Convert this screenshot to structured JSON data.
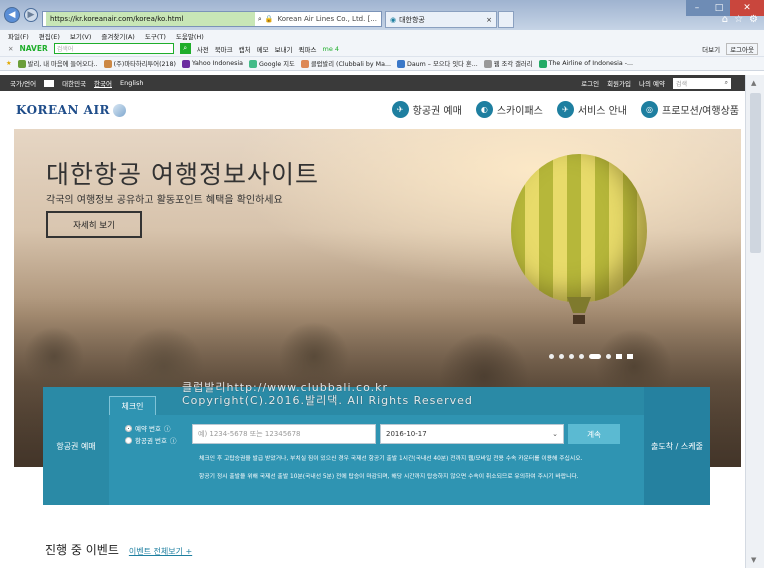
{
  "browser": {
    "url": "https://kr.koreanair.com/korea/ko.html",
    "site_badge": "Korean Air Lines Co., Ltd. [...",
    "tab_title": "대한항공",
    "close_symbol": "×",
    "menu": [
      "파일(F)",
      "편집(E)",
      "보기(V)",
      "즐겨찾기(A)",
      "도구(T)",
      "도움말(H)"
    ],
    "naver": {
      "logo": "NAVER",
      "placeholder": "검색어",
      "tools": [
        "사전",
        "북마크",
        "캡처",
        "메모",
        "보내기",
        "퀵파스",
        "me 4"
      ],
      "right": [
        "더보기",
        "로그아웃"
      ]
    },
    "favorites": [
      "발리, 내 마음에 들어오다..",
      "(주)마타하리투어(218)",
      "Yahoo Indonesia",
      "Google 지도",
      "클럽발리 (Clubbali by Ma...",
      "Daum – 모으다 잇다 혼...",
      "웹 조각 갤러리",
      "The Airline of Indonesia -..."
    ]
  },
  "util": {
    "items": [
      "국가/언어",
      "대한민국",
      "한국어",
      "English"
    ],
    "right": [
      "로그인",
      "회원가입",
      "나의 예약"
    ],
    "search_placeholder": "검색"
  },
  "header": {
    "logo": "KOREAN AIR",
    "nav": [
      {
        "label": "항공권 예매",
        "icon": "ticket-icon"
      },
      {
        "label": "스카이패스",
        "icon": "skypass-icon"
      },
      {
        "label": "서비스 안내",
        "icon": "plane-icon"
      },
      {
        "label": "프로모션/여행상품",
        "icon": "globe-icon"
      }
    ]
  },
  "hero": {
    "title": "대한항공 여행정보사이트",
    "subtitle": "각국의 여행정보 공유하고 활동포인트 혜택을 확인하세요",
    "button": "자세히 보기"
  },
  "watermark": {
    "line1": "클럽발리http://www.clubbali.co.kr",
    "line2": "Copyright(C).2016.발리댁. All Rights Reserved"
  },
  "booking": {
    "left_label": "항공권 예매",
    "tab": "체크인",
    "option1": "예약 번호",
    "option2": "항공권 번호",
    "input_placeholder": "예) 1234-5678 또는 12345678",
    "date": "2016-10-17",
    "submit": "계속",
    "notes": [
      "체크인 후 고탑승권을 발급 받았거나, 부치실 짐이 있으신 경우 국제선 항공기 출발 1시간(국내선 40분) 전까지 웹/모바일 전용 수속 카운터를 이용해 주십시오.",
      "항공기 정시 출발을 위해 국제선 출발 10분(국내선 5분) 전에 탑승이 마감되며, 해당 시간까지 탑승하지 않으면 수속이 취소되므로 유의하여 주시기 바랍니다."
    ],
    "right_label": "출도착 / 스케줄"
  },
  "events": {
    "title": "진행 중 이벤트",
    "link": "이벤트 전체보기 +"
  }
}
